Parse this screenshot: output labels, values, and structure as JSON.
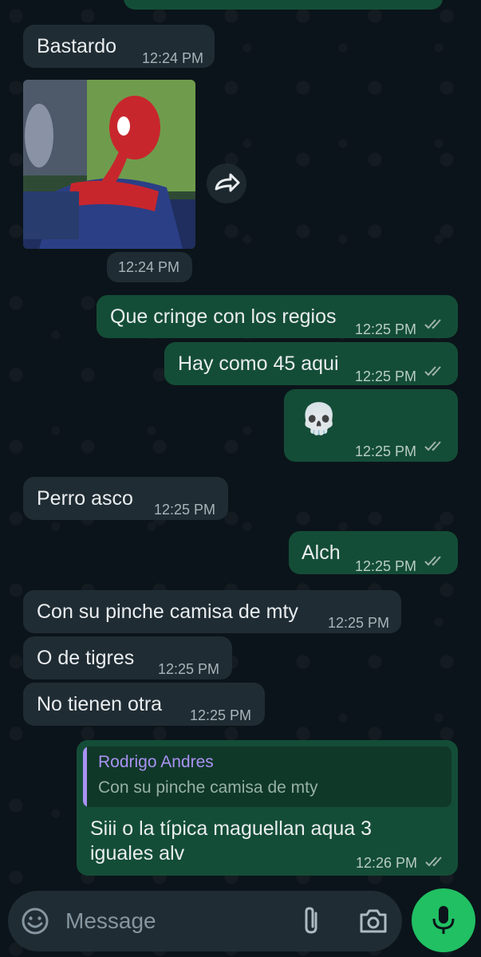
{
  "colors": {
    "background": "#0b141a",
    "incoming_bubble": "#202c33",
    "outgoing_bubble": "#144d37",
    "accent_green": "#21c063",
    "read_ticks": "#9fb3ab",
    "quote_name": "#a992f3"
  },
  "messages": {
    "m1": {
      "text": "Bastardo",
      "time": "12:24 PM"
    },
    "m2": {
      "time": "12:24 PM",
      "image": "spiderman-sticker"
    },
    "m3": {
      "text": "Que cringe con los regios",
      "time": "12:25 PM"
    },
    "m4": {
      "text": "Hay como 45 aqui",
      "time": "12:25 PM"
    },
    "m5": {
      "text": "💀",
      "time": "12:25 PM"
    },
    "m6": {
      "text": "Perro asco",
      "time": "12:25 PM"
    },
    "m7": {
      "text": "Alch",
      "time": "12:25 PM"
    },
    "m8": {
      "text": "Con su pinche camisa de mty",
      "time": "12:25 PM"
    },
    "m9": {
      "text": "O de tigres",
      "time": "12:25 PM"
    },
    "m10": {
      "text": "No tienen otra",
      "time": "12:25 PM"
    },
    "m11": {
      "quote_name": "Rodrigo Andres",
      "quote_text": "Con su pinche camisa de mty",
      "line1": "Siii o la típica maguellan aqua 3",
      "line2": "iguales alv",
      "time": "12:26 PM"
    }
  },
  "composer": {
    "placeholder": "Message",
    "icons": [
      "emoji-icon",
      "paperclip-icon",
      "camera-icon",
      "mic-icon"
    ]
  },
  "forward_icon": "forward-icon"
}
